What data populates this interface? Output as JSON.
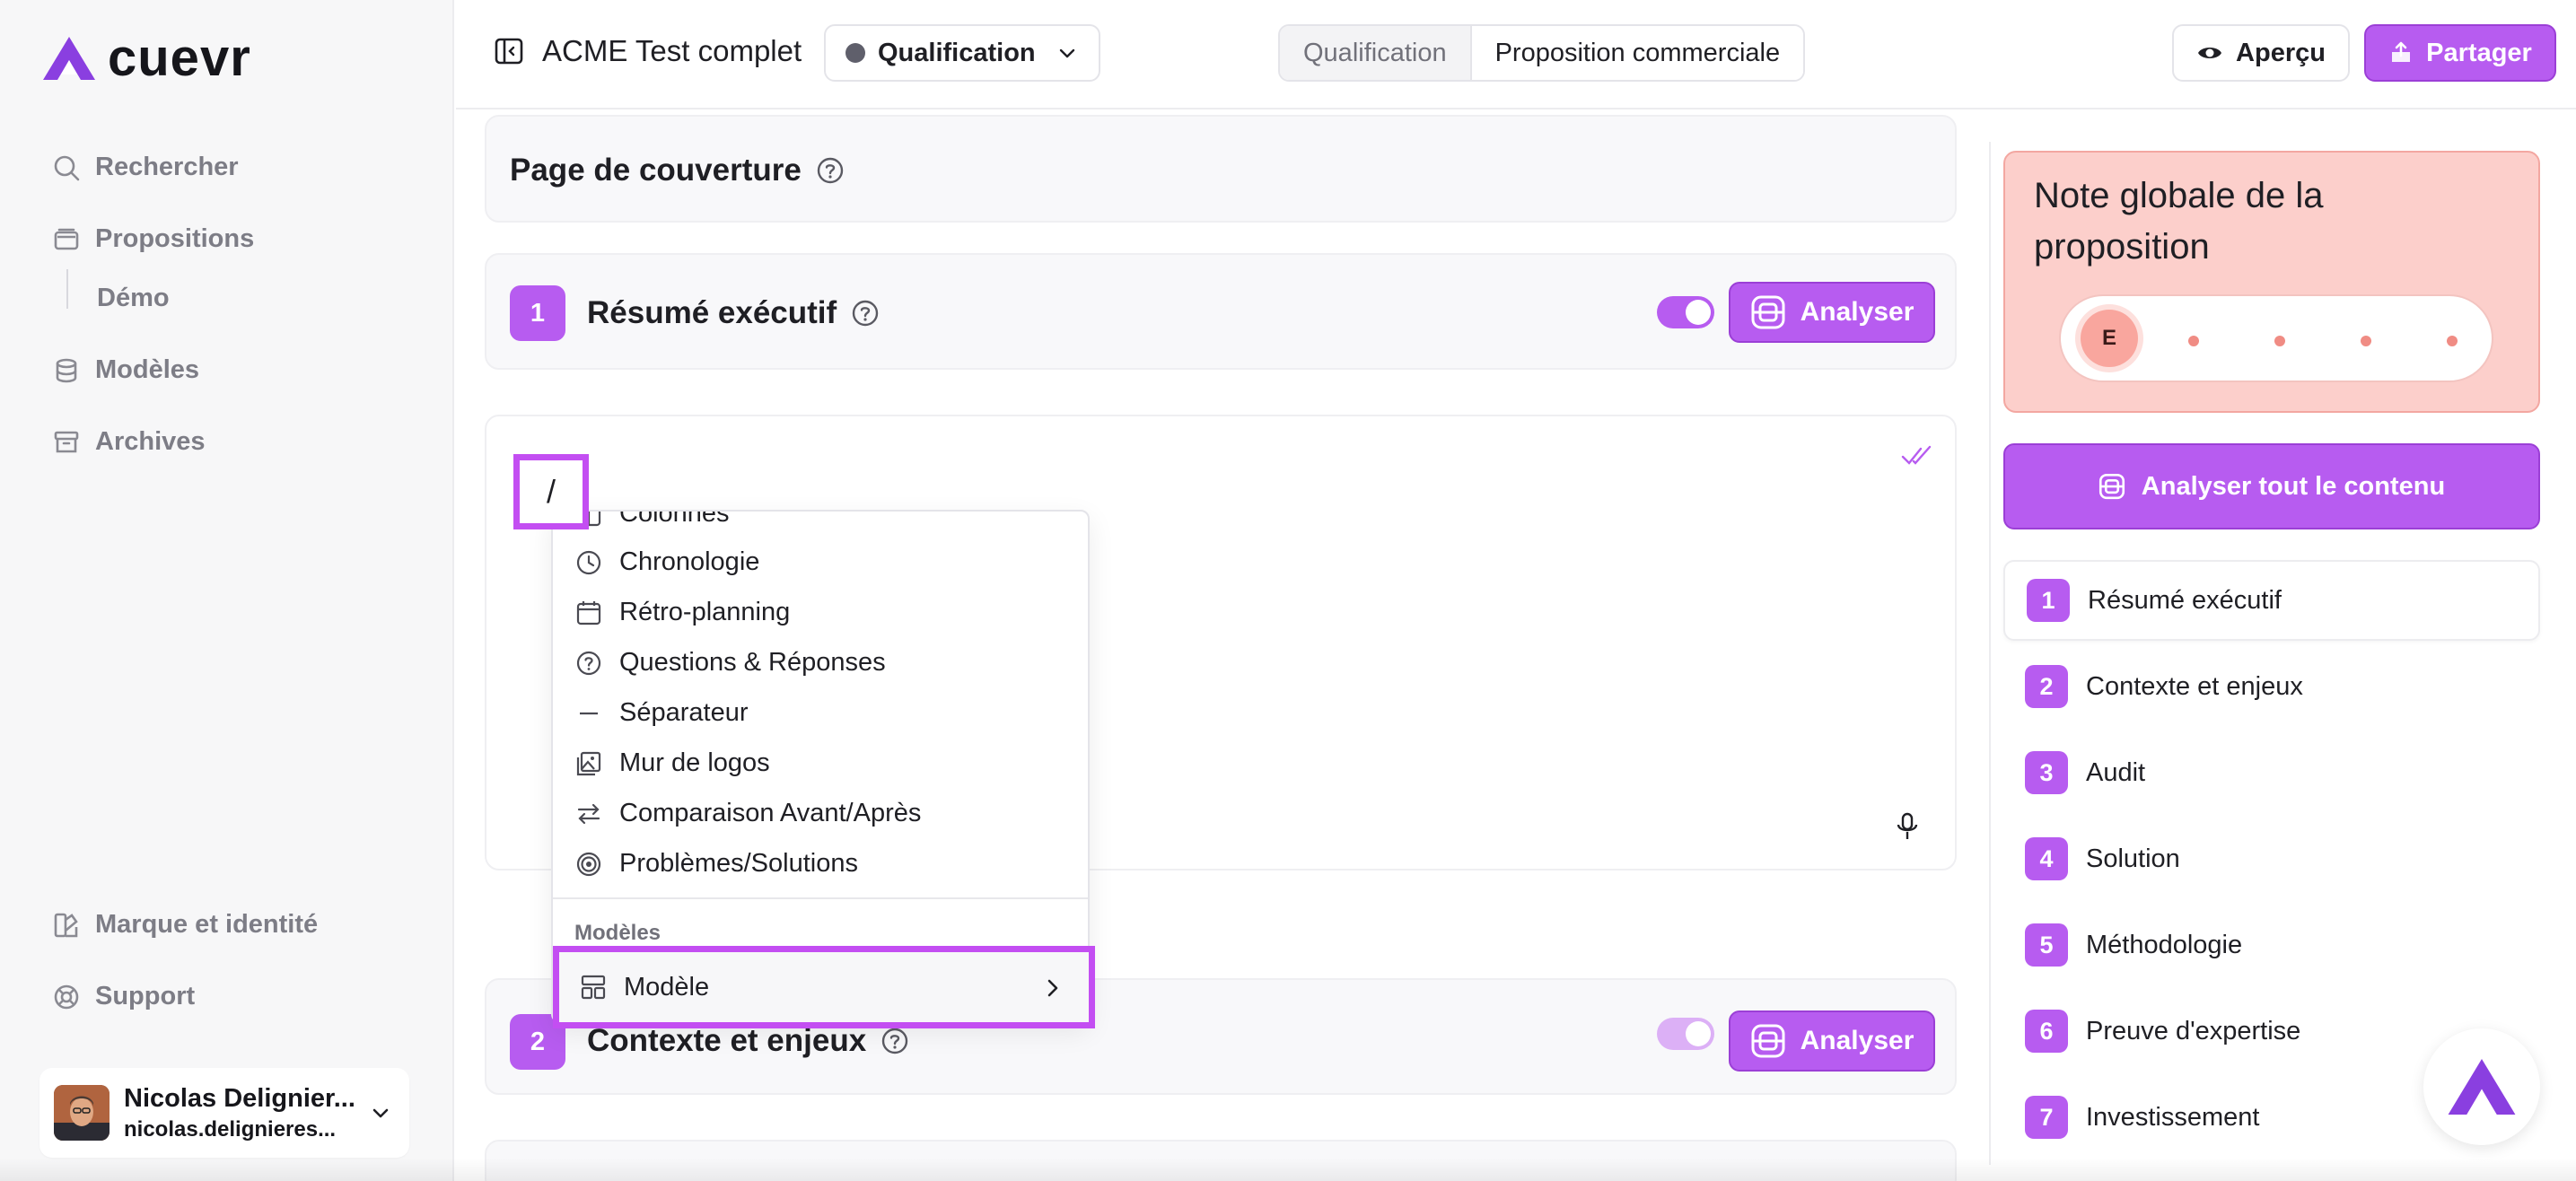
{
  "brand": {
    "name": "cuevr",
    "accent": "#b75cf0",
    "accent_border": "#9b3fd6",
    "highlight": "#c34ef2"
  },
  "sidebar": {
    "items": [
      {
        "label": "Rechercher",
        "icon": "search-icon"
      },
      {
        "label": "Propositions",
        "icon": "folder-icon"
      },
      {
        "label": "Modèles",
        "icon": "database-icon"
      },
      {
        "label": "Archives",
        "icon": "archive-icon"
      }
    ],
    "sub_item": "Démo",
    "bottom_items": [
      {
        "label": "Marque et identité",
        "icon": "palette-icon"
      },
      {
        "label": "Support",
        "icon": "lifebuoy-icon"
      }
    ],
    "user": {
      "name": "Nicolas Delignier...",
      "email": "nicolas.delignieres..."
    }
  },
  "header": {
    "doc_title": "ACME Test complet",
    "status": "Qualification",
    "tabs": [
      "Qualification",
      "Proposition commerciale"
    ],
    "apercu_label": "Aperçu",
    "partager_label": "Partager"
  },
  "editor": {
    "cover_title": "Page de couverture",
    "sections": [
      {
        "num": "1",
        "title": "Résumé exécutif",
        "toggle_on": true
      },
      {
        "num": "2",
        "title": "Contexte et enjeux",
        "toggle_on": true
      }
    ],
    "analyse_label": "Analyser",
    "slash": "/"
  },
  "slash_menu": {
    "partial_item": "Colonnes",
    "items": [
      {
        "label": "Chronologie",
        "icon": "clock-icon"
      },
      {
        "label": "Rétro-planning",
        "icon": "calendar-icon"
      },
      {
        "label": "Questions & Réponses",
        "icon": "help-circle-icon"
      },
      {
        "label": "Séparateur",
        "icon": "minus-icon"
      },
      {
        "label": "Mur de logos",
        "icon": "images-icon"
      },
      {
        "label": "Comparaison Avant/Après",
        "icon": "arrows-swap-icon"
      },
      {
        "label": "Problèmes/Solutions",
        "icon": "target-icon"
      }
    ],
    "section_label": "Modèles",
    "modele_label": "Modèle"
  },
  "right_panel": {
    "score_title": "Note globale de la proposition",
    "score_grade": "E",
    "analyse_all_label": "Analyser tout le contenu",
    "toc": [
      {
        "num": "1",
        "label": "Résumé exécutif"
      },
      {
        "num": "2",
        "label": "Contexte et enjeux"
      },
      {
        "num": "3",
        "label": "Audit"
      },
      {
        "num": "4",
        "label": "Solution"
      },
      {
        "num": "5",
        "label": "Méthodologie"
      },
      {
        "num": "6",
        "label": "Preuve d'expertise"
      },
      {
        "num": "7",
        "label": "Investissement"
      }
    ]
  }
}
